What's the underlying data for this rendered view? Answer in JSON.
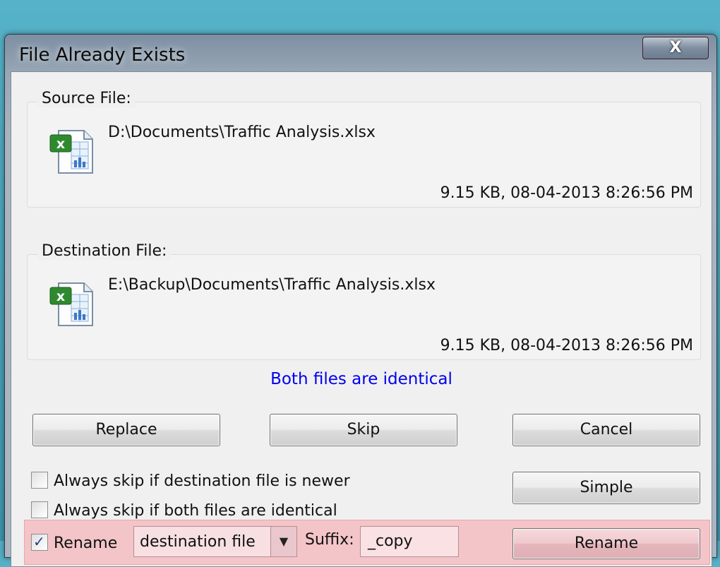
{
  "window": {
    "title": "File Already Exists",
    "close_label": "X"
  },
  "source": {
    "label": "Source File:",
    "path": "D:\\Documents\\Traffic Analysis.xlsx",
    "meta": "9.15 KB, 08-04-2013 8:26:56 PM",
    "icon": "excel-file-icon"
  },
  "destination": {
    "label": "Destination File:",
    "path": "E:\\Backup\\Documents\\Traffic Analysis.xlsx",
    "meta": "9.15 KB, 08-04-2013 8:26:56 PM",
    "icon": "excel-file-icon"
  },
  "status": {
    "text": "Both files are identical",
    "color": "#0000ee"
  },
  "buttons": {
    "replace": "Replace",
    "skip": "Skip",
    "cancel": "Cancel",
    "simple": "Simple",
    "rename": "Rename"
  },
  "options": {
    "skip_newer": {
      "label": "Always skip if destination file is newer",
      "checked": false
    },
    "skip_identical": {
      "label": "Always skip if both files are identical",
      "checked": false
    },
    "rename": {
      "label": "Rename",
      "checked": true
    }
  },
  "rename_row": {
    "target_selected": "destination file",
    "suffix_label": "Suffix:",
    "suffix_value": "_copy",
    "highlight_color": "#f3c4c8"
  }
}
